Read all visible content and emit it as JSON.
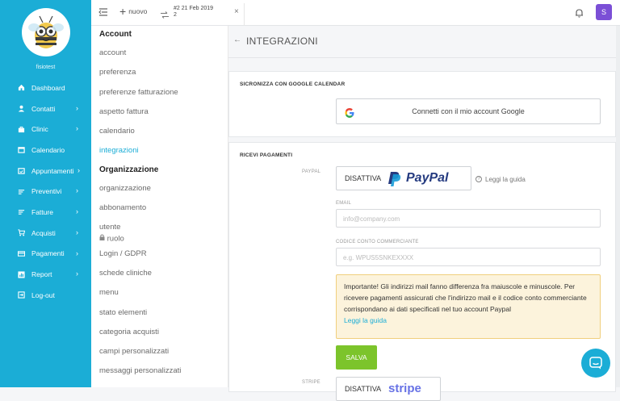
{
  "sidebar": {
    "clinic_name": "fisiotest",
    "items": [
      {
        "label": "Dashboard",
        "icon": "home-icon",
        "chevron": false
      },
      {
        "label": "Contatti",
        "icon": "person-icon",
        "chevron": true
      },
      {
        "label": "Clinic",
        "icon": "briefcase-icon",
        "chevron": true
      },
      {
        "label": "Calendario",
        "icon": "calendar-icon",
        "chevron": false
      },
      {
        "label": "Appuntamenti",
        "icon": "calendar-check-icon",
        "chevron": true
      },
      {
        "label": "Preventivi",
        "icon": "list-icon",
        "chevron": true
      },
      {
        "label": "Fatture",
        "icon": "list-icon",
        "chevron": true
      },
      {
        "label": "Acquisti",
        "icon": "cart-icon",
        "chevron": true
      },
      {
        "label": "Pagamenti",
        "icon": "card-icon",
        "chevron": true
      },
      {
        "label": "Report",
        "icon": "chart-icon",
        "chevron": true
      },
      {
        "label": "Log-out",
        "icon": "logout-icon",
        "chevron": false
      }
    ]
  },
  "topbar": {
    "new_label": "nuovo",
    "tab_title": "#2 21 Feb 2019",
    "tab_subtitle": "2",
    "avatar_letter": "S"
  },
  "settings_menu": {
    "account_heading": "Account",
    "account_items": [
      "account",
      "preferenza",
      "preferenze fatturazione",
      "aspetto fattura",
      "calendario",
      "integrazioni"
    ],
    "org_heading": "Organizzazione",
    "org_items": [
      "organizzazione",
      "abbonamento",
      "utente"
    ],
    "role_label": "ruolo",
    "other_items": [
      "Login / GDPR",
      "schede cliniche",
      "menu",
      "stato elementi",
      "categoria acquisti",
      "campi personalizzati",
      "messaggi personalizzati"
    ]
  },
  "page": {
    "title": "INTEGRAZIONI",
    "google_section_title": "SICRONIZZA CON GOOGLE CALENDAR",
    "google_button": "Connetti con il mio account Google",
    "payments_title": "RICEVI PAGAMENTI",
    "paypal_label": "PAYPAL",
    "paypal_button": "DISATTIVA",
    "paypal_brand": "PayPal",
    "guide_link": "Leggi la guida",
    "email_label": "EMAIL",
    "email_placeholder": "info@company.com",
    "merchant_label": "CODICE CONTO COMMERCIANTE",
    "merchant_placeholder": "e.g. WPUS5SNKEXXXX",
    "alert_text": "Importante! Gli indirizzi mail fanno differenza fra maiuscole e minuscole. Per ricevere pagamenti assicurati che l'indirizzo mail e il codice conto commerciante corrispondano ai dati specificati nel tuo account Paypal",
    "alert_link": "Leggi la guida",
    "save_button": "SALVA",
    "stripe_label": "STRIPE",
    "stripe_button": "DISATTIVA",
    "stripe_brand": "stripe"
  },
  "colors": {
    "sidebar": "#1badd6",
    "save": "#7cc42b",
    "alert_bg": "#fcf3dc",
    "alert_border": "#f0cf7d",
    "link": "#1badd6",
    "avatar": "#7b4fd6"
  }
}
